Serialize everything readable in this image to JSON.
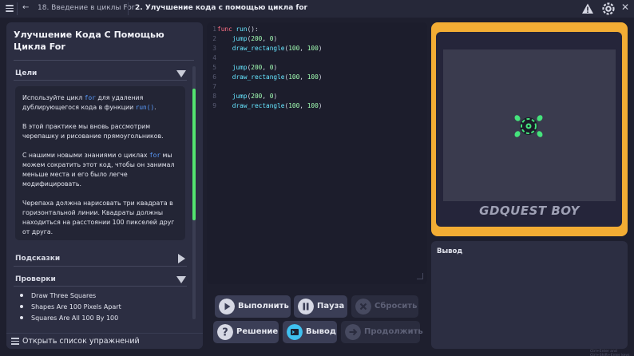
{
  "topbar": {
    "menu_icon": "hamburger-icon",
    "back_icon": "arrow-left-icon",
    "breadcrumb_lesson": "18. Введение в циклы For",
    "breadcrumb_practice": "2. Улучшение кода с помощью цикла for",
    "warning_icon": "warning-icon",
    "settings_icon": "gear-icon",
    "close_icon": "close-icon"
  },
  "sidebar": {
    "title": "Улучшение Кода С Помощью Цикла For",
    "goals_header": "Цели",
    "goals": {
      "p1_before": "Используйте цикл ",
      "p1_kw1": "for",
      "p1_mid": " для удаления дублирующегося кода в функции ",
      "p1_kw2": "run()",
      "p1_after": ".",
      "p2": "В этой практике мы вновь рассмотрим черепашку и рисование прямоугольников.",
      "p3_before": "С нашими новыми знаниями о циклах ",
      "p3_kw": "for",
      "p3_after": " мы можем сократить этот код, чтобы он занимал меньше места и его было легче модифицировать.",
      "p4": "Черепаха должна нарисовать три квадрата в горизонтальной линии. Квадраты должны находиться на расстоянии 100 пикселей друг от друга."
    },
    "hints_header": "Подсказки",
    "checks_header": "Проверки",
    "checks": [
      "Draw Three Squares",
      "Shapes Are 100 Pixels Apart",
      "Squares Are All 100 By 100"
    ],
    "open_list_label": "Открыть список упражнений"
  },
  "editor": {
    "lines": [
      {
        "n": "1"
      },
      {
        "n": "2"
      },
      {
        "n": "3"
      },
      {
        "n": "4"
      },
      {
        "n": "5"
      },
      {
        "n": "6"
      },
      {
        "n": "7"
      },
      {
        "n": "8"
      },
      {
        "n": "9"
      }
    ],
    "code": {
      "func_kw": "func",
      "run_name": "run",
      "run_tail": "():",
      "jump": "jump",
      "draw": "draw_rectangle",
      "n200": "200",
      "n0": "0",
      "n100": "100",
      "comma": ", ",
      "lp": "(",
      "rp": ")"
    }
  },
  "game": {
    "brand": "GDQUEST BOY",
    "turtle_icon": "turtle-icon"
  },
  "output": {
    "label": "Вывод"
  },
  "controls": {
    "run_label": "Выполнить",
    "pause_label": "Пауза",
    "reset_label": "Сбросить",
    "solution_label": "Решение",
    "output_label": "Вывод",
    "continue_label": "Продолжить"
  },
  "watermark": "Ctrl+Enter and Ctrl+Shift+Enter keys",
  "colors": {
    "background": "#1e1f2e",
    "panel": "#2c2e42",
    "accent_green": "#53e46f",
    "console_orange": "#f3ad34",
    "keyword": "#ff7085",
    "function": "#66e6ff",
    "number": "#a3ffb4"
  }
}
